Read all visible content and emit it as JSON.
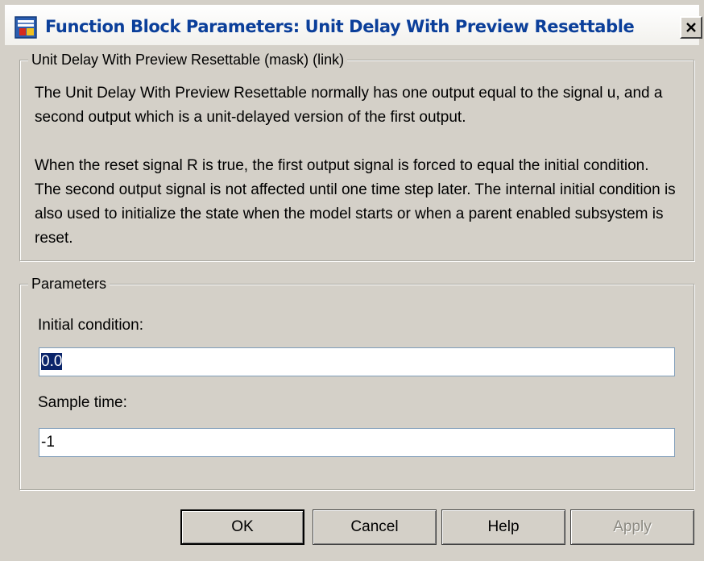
{
  "window": {
    "title": "Function Block Parameters: Unit Delay With Preview Resettable",
    "close_glyph": "✕"
  },
  "description": {
    "legend": "Unit Delay With Preview Resettable (mask) (link)",
    "paragraph1": "The Unit Delay With Preview Resettable normally has one output equal to the signal u, and a second output which is a unit-delayed version of the first output.",
    "paragraph2": "When the reset signal R is true, the first output signal is forced to equal the initial condition.  The second output signal is not affected until one time step later.  The internal initial condition is also used to initialize the state when the model starts or when a parent enabled subsystem is reset."
  },
  "parameters": {
    "legend": "Parameters",
    "initial_condition_label": "Initial condition:",
    "initial_condition_value": "0.0",
    "sample_time_label": "Sample time:",
    "sample_time_value": "-1"
  },
  "buttons": {
    "ok": "OK",
    "cancel": "Cancel",
    "help": "Help",
    "apply": "Apply"
  },
  "icons": {
    "app": "simulink-block-icon",
    "close": "close-icon"
  },
  "colors": {
    "title_text": "#0b3f9a",
    "selection": "#0a246a",
    "dialog_bg": "#d4d0c8"
  }
}
